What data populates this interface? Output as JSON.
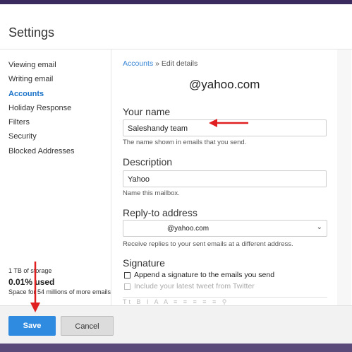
{
  "dialog": {
    "title": "Settings"
  },
  "sidebar": {
    "items": [
      {
        "label": "Viewing email",
        "active": false
      },
      {
        "label": "Writing email",
        "active": false
      },
      {
        "label": "Accounts",
        "active": true
      },
      {
        "label": "Holiday Response",
        "active": false
      },
      {
        "label": "Filters",
        "active": false
      },
      {
        "label": "Security",
        "active": false
      },
      {
        "label": "Blocked Addresses",
        "active": false
      }
    ],
    "storage": {
      "capacity": "1 TB of storage",
      "used": "0.01% used",
      "remaining": "Space for 54 millions of more emails"
    }
  },
  "breadcrumb": {
    "link": "Accounts",
    "separator": "»",
    "current": "Edit details"
  },
  "account": {
    "email": "@yahoo.com"
  },
  "form": {
    "name": {
      "label": "Your name",
      "value": "Saleshandy team",
      "help": "The name shown in emails that you send."
    },
    "description": {
      "label": "Description",
      "value": "Yahoo",
      "help": "Name this mailbox."
    },
    "reply_to": {
      "label": "Reply-to address",
      "value": "@yahoo.com",
      "help": "Receive replies to your sent emails at a different address."
    },
    "signature": {
      "label": "Signature",
      "append_label": "Append a signature to the emails you send",
      "tweet_label": "Include your latest tweet from Twitter",
      "toolbar": "Tt B I A A ≡ ≡ ≡ ≡ ≡ ⚲"
    }
  },
  "footer": {
    "save_label": "Save",
    "cancel_label": "Cancel"
  },
  "colors": {
    "accent": "#2f8be0",
    "link": "#3b86d6",
    "annotation_arrow": "#e02020"
  }
}
